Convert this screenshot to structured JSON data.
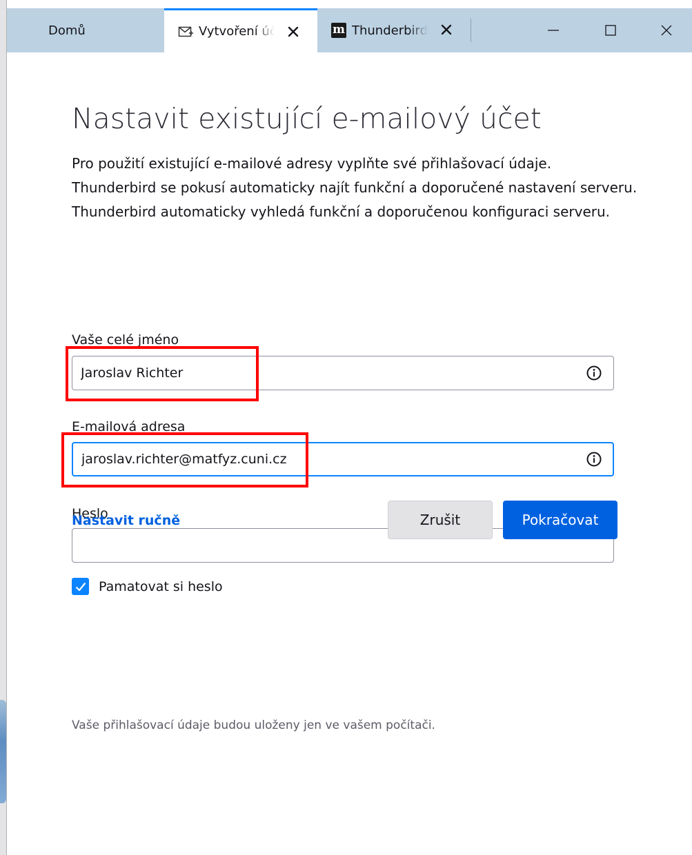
{
  "tabs": [
    {
      "label": "Domů",
      "icon": "home"
    },
    {
      "label": "Vytvoření účtu",
      "icon": "new-account-mail-icon",
      "close": "close-icon"
    },
    {
      "label": "Thunderbird",
      "icon": "m-favicon",
      "icon_text": "m",
      "close": "close-icon"
    }
  ],
  "window_controls": [
    "minimize-icon",
    "maximize-icon",
    "close-icon"
  ],
  "page": {
    "title": "Nastavit existující e-mailový účet",
    "intro_lines": [
      "Pro použití existující e-mailové adresy vyplňte své přihlašovací údaje.",
      "Thunderbird se pokusí automaticky najít funkční a doporučené nastavení serveru.",
      "Thunderbird automaticky vyhledá funkční a doporučenou konfiguraci serveru."
    ]
  },
  "form": {
    "name": {
      "label": "Vaše celé jméno",
      "value": "Jaroslav Richter"
    },
    "email": {
      "label": "E-mailová adresa",
      "value": "jaroslav.richter@matfyz.cuni.cz"
    },
    "password": {
      "label": "Heslo",
      "value": ""
    },
    "remember": {
      "label": "Pamatovat si heslo",
      "checked": true
    }
  },
  "actions": {
    "manual": "Nastavit ručně",
    "cancel": "Zrušit",
    "continue": "Pokračovat"
  },
  "footnote": "Vaše přihlašovací údaje budou uloženy jen ve vašem počítači.",
  "colors": {
    "accent": "#0a84ff",
    "primary_button": "#0061e0",
    "link": "#0060df",
    "tab_strip": "#bcd2e3",
    "highlight": "#ff0000"
  }
}
